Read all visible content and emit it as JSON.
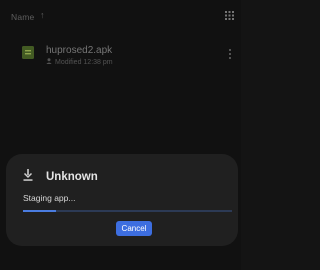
{
  "list_header": {
    "sort_label": "Name",
    "sort_direction_icon": "arrow-up-icon",
    "view_toggle_icon": "grid-view-icon"
  },
  "file": {
    "icon": "apk-file-icon",
    "name": "huprosed2.apk",
    "meta_icon": "person-icon",
    "meta": "Modified 12:38 pm",
    "menu_icon": "more-vertical-icon"
  },
  "dialog": {
    "icon": "download-icon",
    "title": "Unknown",
    "status": "Staging app...",
    "progress_fraction": 0.16,
    "cancel_label": "Cancel"
  },
  "colors": {
    "accent": "#3d6ee0",
    "file_icon": "#4f6b2a",
    "background": "#141414",
    "dialog_bg": "#202020"
  }
}
